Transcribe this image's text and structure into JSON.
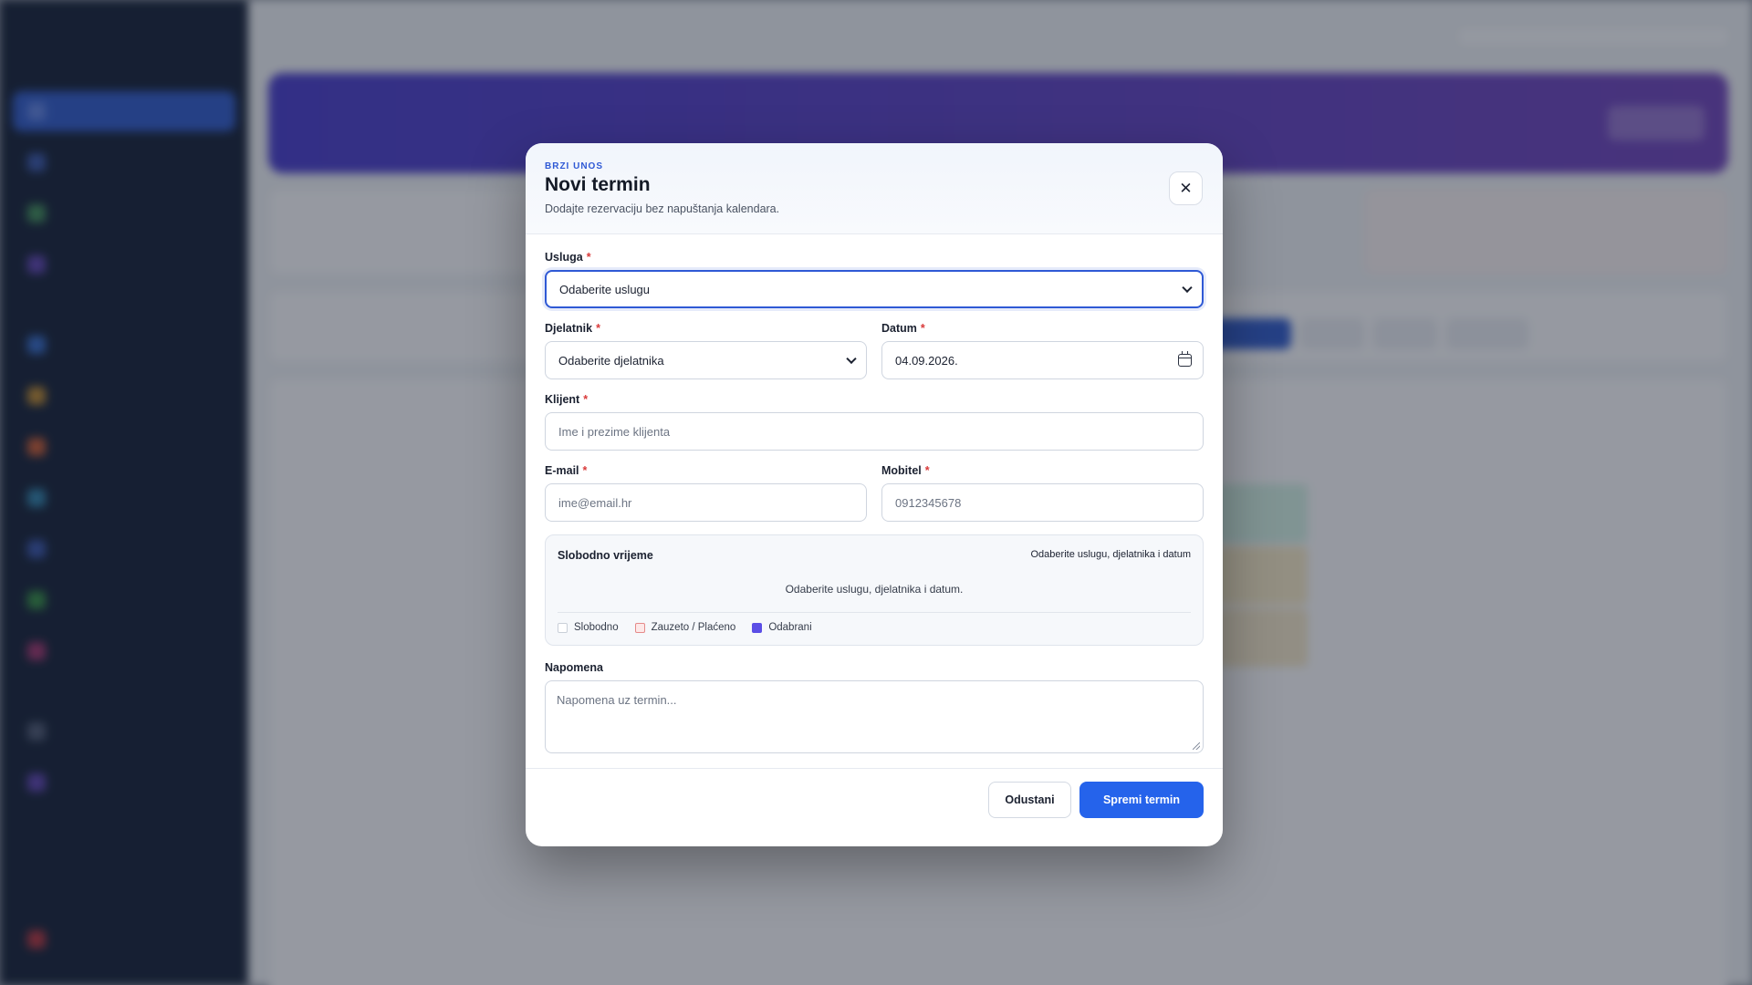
{
  "modal": {
    "eyebrow": "BRZI UNOS",
    "title": "Novi termin",
    "subtitle": "Dodajte rezervaciju bez napuštanja kalendara.",
    "close_icon": "close-icon",
    "fields": {
      "service": {
        "label": "Usluga",
        "required_mark": "*",
        "value": "Odaberite uslugu"
      },
      "employee": {
        "label": "Djelatnik",
        "required_mark": "*",
        "value": "Odaberite djelatnika"
      },
      "date": {
        "label": "Datum",
        "required_mark": "*",
        "value": "04.09.2026.",
        "icon": "calendar-icon"
      },
      "client": {
        "label": "Klijent",
        "required_mark": "*",
        "placeholder": "Ime i prezime klijenta"
      },
      "email": {
        "label": "E-mail",
        "required_mark": "*",
        "placeholder": "ime@email.hr"
      },
      "mobile": {
        "label": "Mobitel",
        "required_mark": "*",
        "placeholder": "0912345678"
      },
      "note": {
        "label": "Napomena",
        "placeholder": "Napomena uz termin..."
      }
    },
    "free_slots": {
      "title": "Slobodno vrijeme",
      "hint": "Odaberite uslugu, djelatnika i datum",
      "message": "Odaberite uslugu, djelatnika i datum.",
      "legend": [
        {
          "label": "Slobodno",
          "color": "#ffffff",
          "border": "#c9cfd8"
        },
        {
          "label": "Zauzeto / Plaćeno",
          "color": "#fde8e8",
          "border": "#e58a8a"
        },
        {
          "label": "Odabrani",
          "color": "#5b4ee6",
          "border": "#5b4ee6"
        }
      ]
    },
    "buttons": {
      "cancel": "Odustani",
      "save": "Spremi termin"
    }
  },
  "colors": {
    "accent": "#2563eb",
    "required": "#d93a3a",
    "eyebrow": "#2f59d5"
  }
}
